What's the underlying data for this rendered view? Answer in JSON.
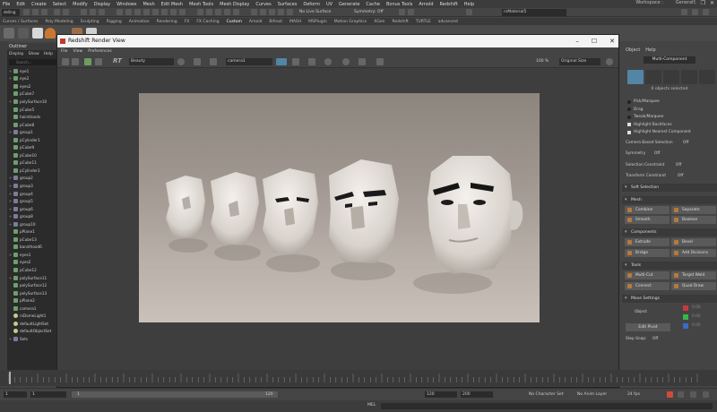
{
  "menubar": {
    "items": [
      "File",
      "Edit",
      "Create",
      "Select",
      "Modify",
      "Display",
      "Windows",
      "Mesh",
      "Edit Mesh",
      "Mesh Tools",
      "Mesh Display",
      "Curves",
      "Surfaces",
      "Deform",
      "UV",
      "Generate",
      "Cache",
      "Bonus Tools",
      "Arnold",
      "Redshift",
      "Help"
    ],
    "workspace_label": "Workspace :",
    "workspace_value": "General*"
  },
  "statusline": {
    "mode": "delling",
    "live_surface": "No Live Surface",
    "symmetry": "Symmetry: Off",
    "material_field": "rsMaterial5"
  },
  "shelf": {
    "tabs": [
      "Curves / Surfaces",
      "Poly Modeling",
      "Sculpting",
      "Rigging",
      "Animation",
      "Rendering",
      "FX",
      "FX Caching",
      "Custom",
      "Arnold",
      "Bifrost",
      "MASH",
      "MSPlugin",
      "Motion Graphics",
      "XGen",
      "Redshift",
      "TURTLE",
      "advanced"
    ],
    "active_tab": "Custom"
  },
  "outliner": {
    "title": "Outliner",
    "menu": [
      "Display",
      "Show",
      "Help"
    ],
    "search_placeholder": "Search...",
    "items": [
      {
        "name": "eye1",
        "kind": "shape",
        "expand": "+"
      },
      {
        "name": "eye2",
        "kind": "shape",
        "expand": "+"
      },
      {
        "name": "eyes2",
        "kind": "shape",
        "expand": ""
      },
      {
        "name": "pCube7",
        "kind": "shape",
        "expand": ""
      },
      {
        "name": "polySurface10",
        "kind": "shape",
        "expand": "+"
      },
      {
        "name": "pCube5",
        "kind": "shape",
        "expand": ""
      },
      {
        "name": "hairstloods",
        "kind": "shape",
        "expand": ""
      },
      {
        "name": "pCube8",
        "kind": "shape",
        "expand": ""
      },
      {
        "name": "group1",
        "kind": "grp",
        "expand": "+"
      },
      {
        "name": "pCylinder1",
        "kind": "shape",
        "expand": ""
      },
      {
        "name": "pCube9",
        "kind": "shape",
        "expand": ""
      },
      {
        "name": "pCube10",
        "kind": "shape",
        "expand": ""
      },
      {
        "name": "pCube11",
        "kind": "shape",
        "expand": ""
      },
      {
        "name": "pCylinder2",
        "kind": "shape",
        "expand": ""
      },
      {
        "name": "group2",
        "kind": "grp",
        "expand": "+"
      },
      {
        "name": "group3",
        "kind": "grp",
        "expand": "+"
      },
      {
        "name": "group4",
        "kind": "grp",
        "expand": "+"
      },
      {
        "name": "group5",
        "kind": "grp",
        "expand": "+"
      },
      {
        "name": "group6",
        "kind": "grp",
        "expand": "+"
      },
      {
        "name": "group8",
        "kind": "grp",
        "expand": "+"
      },
      {
        "name": "group10",
        "kind": "grp",
        "expand": "+"
      },
      {
        "name": "pPlane1",
        "kind": "shape",
        "expand": ""
      },
      {
        "name": "pCube13",
        "kind": "shape",
        "expand": ""
      },
      {
        "name": "bansthood6",
        "kind": "shape",
        "expand": ""
      },
      {
        "name": "eyes1",
        "kind": "shape",
        "expand": "+"
      },
      {
        "name": "eyes2",
        "kind": "shape",
        "expand": ""
      },
      {
        "name": "pCube12",
        "kind": "shape",
        "expand": ""
      },
      {
        "name": "polySurface11",
        "kind": "shape",
        "expand": "+"
      },
      {
        "name": "polySurface12",
        "kind": "shape",
        "expand": ""
      },
      {
        "name": "polySurface13",
        "kind": "shape",
        "expand": ""
      },
      {
        "name": "pPlane2",
        "kind": "shape",
        "expand": ""
      },
      {
        "name": "camera1",
        "kind": "shape",
        "expand": ""
      },
      {
        "name": "rsDomeLight1",
        "kind": "light",
        "expand": ""
      },
      {
        "name": "defaultLightSet",
        "kind": "light",
        "expand": ""
      },
      {
        "name": "defaultObjectSet",
        "kind": "light",
        "expand": ""
      },
      {
        "name": "Sets",
        "kind": "grp",
        "expand": "+"
      }
    ]
  },
  "render_view": {
    "title": "Redshift Render View",
    "menu": [
      "File",
      "View",
      "Preferences"
    ],
    "aov": "Beauty",
    "rt_label": "RT",
    "camera": "camera1",
    "zoom": "100 %",
    "size_mode": "Original Size"
  },
  "modeling_toolkit": {
    "menu": [
      "Object",
      "Help"
    ],
    "tab": "Multi-Component",
    "selection_info": "0 objects selected",
    "options": [
      {
        "label": "Pick/Marquee",
        "checked": false,
        "radio": true
      },
      {
        "label": "Drag",
        "checked": false,
        "radio": true
      },
      {
        "label": "Tweak/Marquee",
        "checked": false,
        "radio": true
      },
      {
        "label": "Highlight Backfaces",
        "checked": true,
        "radio": false
      },
      {
        "label": "Highlight Nearest Component",
        "checked": true,
        "radio": false
      }
    ],
    "camera_based": {
      "label": "Camera Based Selection",
      "value": "Off"
    },
    "symmetry": {
      "label": "Symmetry",
      "value": "Off"
    },
    "selection_constraint": {
      "label": "Selection Constraint",
      "value": "Off"
    },
    "transform_constraint": {
      "label": "Transform Constraint",
      "value": "Off"
    },
    "soft_selection": "Soft Selection",
    "mesh_section": "Mesh",
    "mesh_buttons": [
      "Combine",
      "Separate",
      "Smooth",
      "Boolean"
    ],
    "components_section": "Components",
    "components_buttons": [
      "Extrude",
      "Bevel",
      "Bridge",
      "Add Divisions"
    ],
    "tools_section": "Tools",
    "tools_buttons": [
      "Multi-Cut",
      "Target Weld",
      "Connect",
      "Quad Draw"
    ],
    "move_section": "Move Settings",
    "move_space": "Object",
    "xyz": {
      "x": "0.00",
      "y": "0.00",
      "z": "0.00"
    },
    "edit_pivot": "Edit Pivot",
    "step_snap": {
      "label": "Step Snap:",
      "value": "Off"
    }
  },
  "timeline": {
    "current_frame": "1",
    "start": "1",
    "slider_start": "1",
    "slider_end": "120",
    "end": "120",
    "anim_end": "200",
    "character_set": "No Character Set",
    "anim_layer": "No Anim Layer",
    "fps": "24 fps"
  },
  "command_line": {
    "label": "MEL"
  },
  "colors": {
    "accent": "#5285a6",
    "x": "#c93a3a",
    "y": "#3ab54a",
    "z": "#3a6ac9"
  }
}
